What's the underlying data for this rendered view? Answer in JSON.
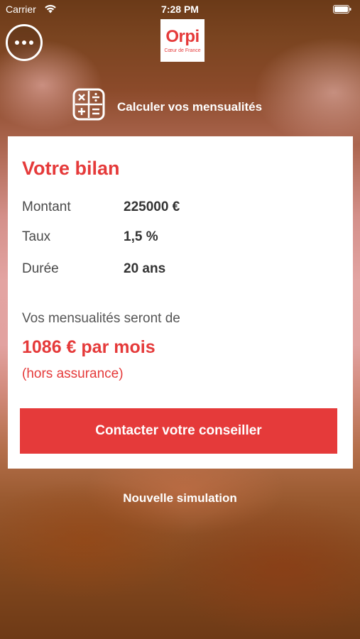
{
  "status_bar": {
    "carrier": "Carrier",
    "time": "7:28 PM"
  },
  "logo": {
    "brand": "Orpi",
    "subtitle": "Cœur de France"
  },
  "header": {
    "title": "Calculer vos mensualités"
  },
  "card": {
    "title": "Votre bilan",
    "rows": [
      {
        "label": "Montant",
        "value": "225000 €"
      },
      {
        "label": "Taux",
        "value": "1,5 %"
      },
      {
        "label": "Durée",
        "value": "20 ans"
      }
    ],
    "summary_label": "Vos mensualités seront de",
    "summary_amount": "1086 € par mois",
    "summary_note": "(hors assurance)",
    "contact_button": "Contacter votre conseiller"
  },
  "footer": {
    "new_simulation": "Nouvelle simulation"
  },
  "colors": {
    "accent": "#e53a3a"
  },
  "icons": [
    "wifi-icon",
    "battery-icon",
    "more-icon",
    "calculator-icon"
  ]
}
